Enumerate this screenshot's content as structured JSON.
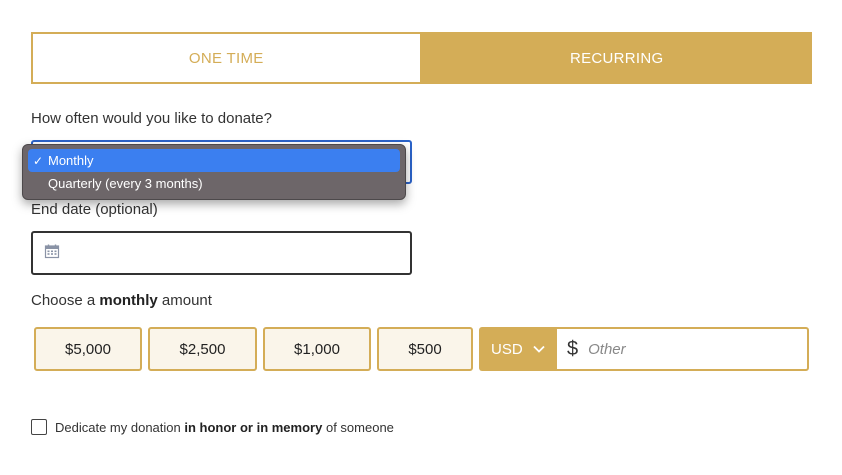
{
  "frequency_tabs": {
    "one_time": "ONE TIME",
    "recurring": "RECURRING",
    "active": "recurring"
  },
  "frequency": {
    "question": "How often would you like to donate?",
    "options": [
      {
        "check": "✓",
        "label": "Monthly",
        "selected": true
      },
      {
        "check": "",
        "label": "Quarterly (every 3 months)",
        "selected": false
      }
    ]
  },
  "end_date": {
    "label": "End date (optional)",
    "value": "",
    "icon": "calendar-icon"
  },
  "amount": {
    "label_prefix": "Choose a",
    "label_bold": "monthly",
    "label_suffix": "amount",
    "presets": [
      "$5,000",
      "$2,500",
      "$1,000",
      "$500"
    ],
    "currency": "USD",
    "currency_symbol": "$",
    "other_placeholder": "Other"
  },
  "dedication": {
    "text_1": "Dedicate my donation",
    "text_bold": "in honor or in memory",
    "text_2": "of someone",
    "checked": false
  },
  "colors": {
    "accent": "#d4ad57",
    "focus": "#2b63c9",
    "menu_bg": "#6d6669",
    "menu_selected": "#3b7ff0"
  }
}
